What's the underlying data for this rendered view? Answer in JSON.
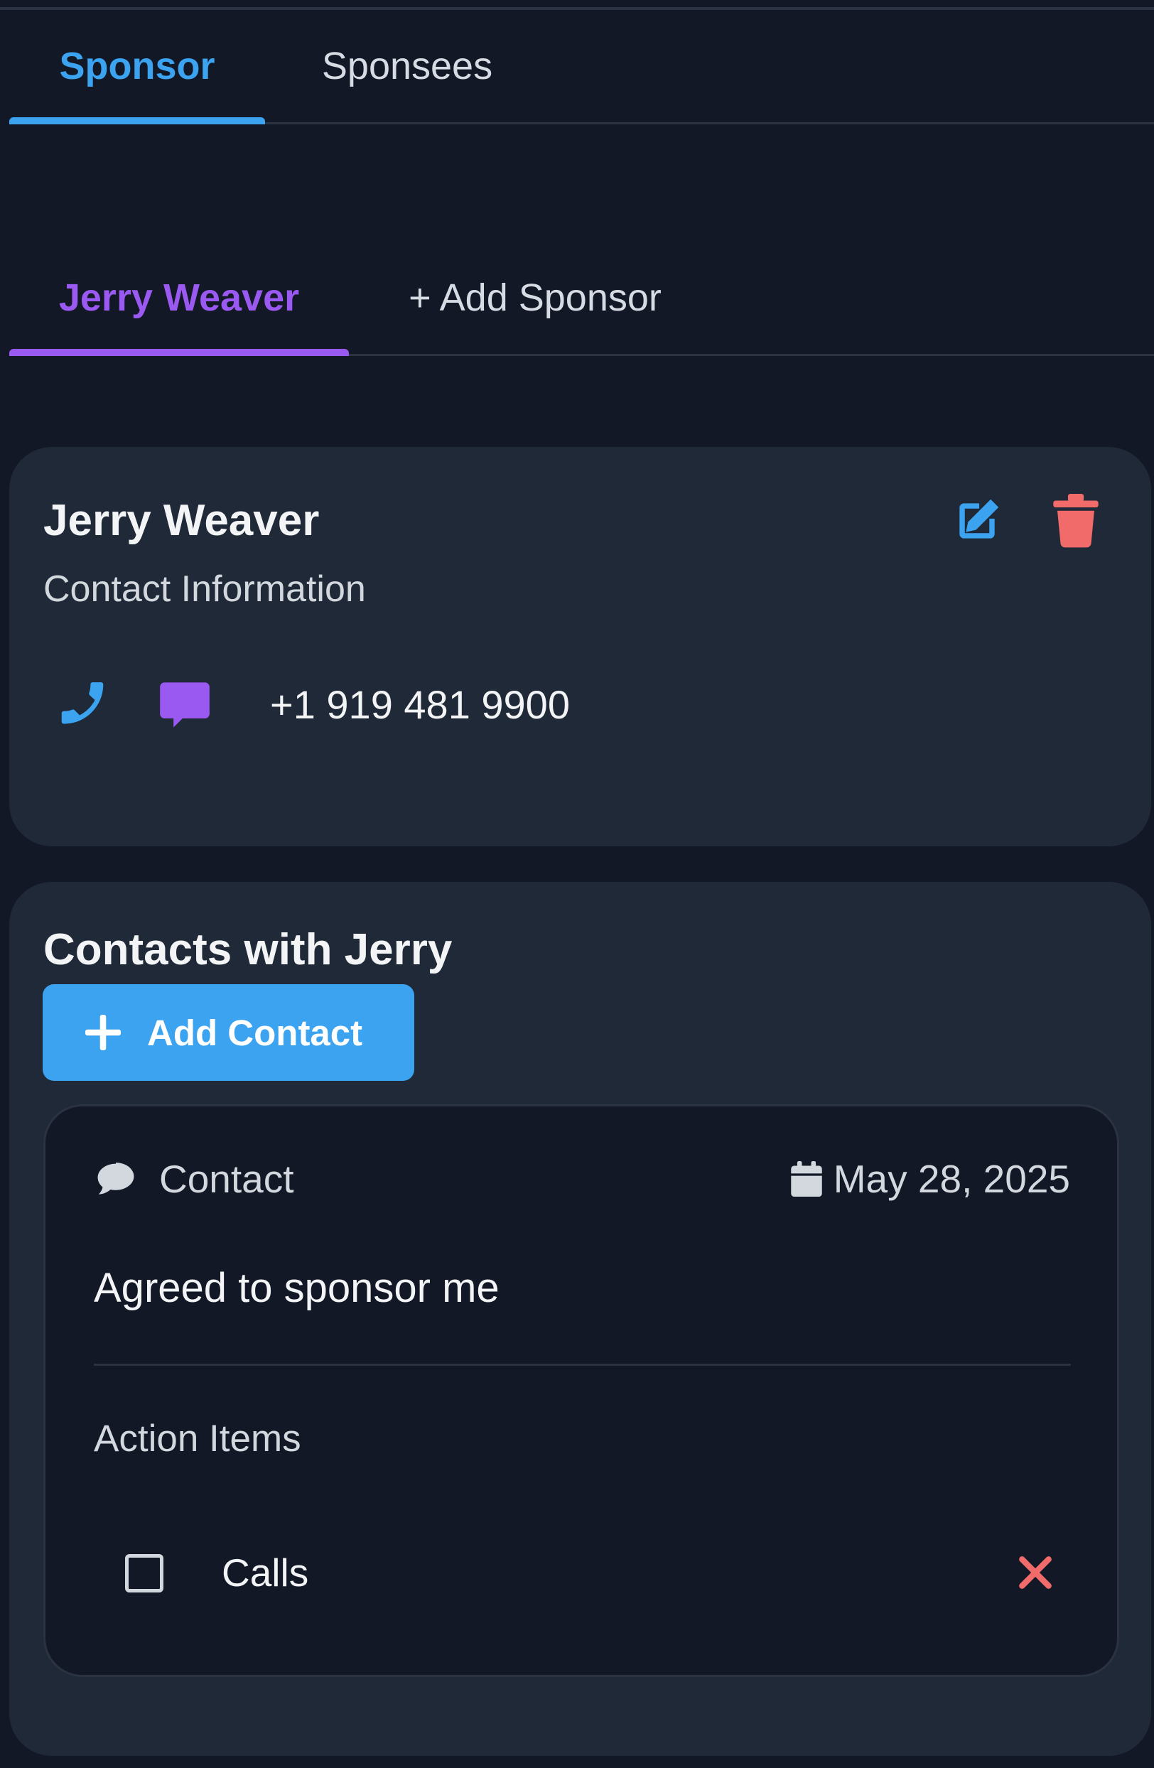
{
  "tabs": {
    "items": [
      {
        "label": "Sponsor",
        "active": true
      },
      {
        "label": "Sponsees",
        "active": false
      }
    ]
  },
  "sponsor_tabs": {
    "items": [
      {
        "label": "Jerry Weaver",
        "active": true
      },
      {
        "label": "+ Add Sponsor",
        "active": false
      }
    ]
  },
  "sponsor_card": {
    "name": "Jerry Weaver",
    "subtitle": "Contact Information",
    "phone": "+1 919 481 9900",
    "edit_icon": "edit-icon",
    "delete_icon": "trash-icon",
    "call_icon": "phone-icon",
    "message_icon": "message-icon"
  },
  "contacts": {
    "title": "Contacts with Jerry",
    "add_button_label": "Add Contact",
    "entries": [
      {
        "type": "Contact",
        "date": "May 28, 2025",
        "note": "Agreed to sponsor me",
        "action_items_title": "Action Items",
        "action_items": [
          {
            "label": "Calls",
            "checked": false
          }
        ]
      }
    ]
  },
  "colors": {
    "background": "#121826",
    "card": "#1f2937",
    "accent_blue": "#3ba3f0",
    "accent_purple": "#9a59f0",
    "danger_red": "#f26b6b"
  }
}
